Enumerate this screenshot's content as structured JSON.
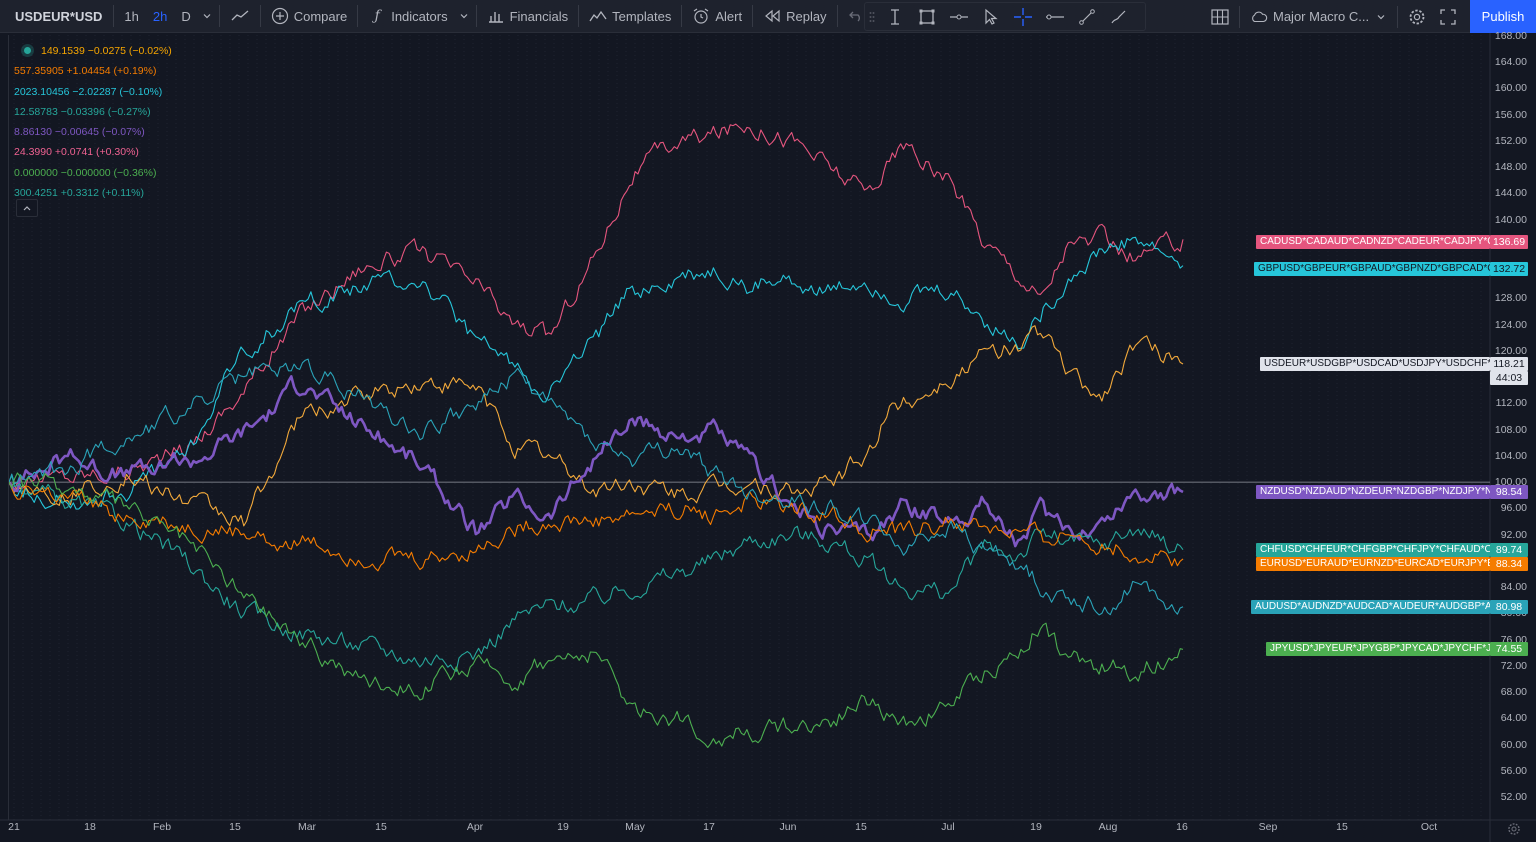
{
  "toolbar": {
    "symbol": "USDEUR*USD",
    "intervals": [
      "1h",
      "2h",
      "D"
    ],
    "active_interval": "2h",
    "compare_label": "Compare",
    "indicators_label": "Indicators",
    "financials_label": "Financials",
    "templates_label": "Templates",
    "alert_label": "Alert",
    "replay_label": "Replay",
    "layout_name": "Major Macro C...",
    "publish_label": "Publish"
  },
  "legend": [
    {
      "text": "149.1539  −0.0275 (−0.02%)",
      "color": "#f7a600"
    },
    {
      "text": "557.35905  +1.04454 (+0.19%)",
      "color": "#f57c00"
    },
    {
      "text": "2023.10456  −2.02287 (−0.10%)",
      "color": "#26c6da"
    },
    {
      "text": "12.58783  −0.03396 (−0.27%)",
      "color": "#26a69a"
    },
    {
      "text": "8.86130  −0.00645 (−0.07%)",
      "color": "#7e57c2"
    },
    {
      "text": "24.3990  +0.0741 (+0.30%)",
      "color": "#f06292"
    },
    {
      "text": "0.000000  −0.000000 (−0.36%)",
      "color": "#4caf50"
    },
    {
      "text": "300.4251  +0.3312 (+0.11%)",
      "color": "#26a69a"
    }
  ],
  "chart_data": {
    "type": "line",
    "title": "",
    "xlabel": "",
    "ylabel": "",
    "ylim": [
      48,
      169
    ],
    "grid": true,
    "y_ticks": [
      168,
      164,
      160,
      156,
      152,
      148,
      144,
      140,
      136,
      132,
      128,
      124,
      120,
      116,
      112,
      108,
      104,
      100,
      96,
      92,
      88,
      84,
      80,
      76,
      72,
      68,
      64,
      60,
      56,
      52
    ],
    "x_ticks": [
      "21",
      "18",
      "Feb",
      "15",
      "Mar",
      "15",
      "Apr",
      "19",
      "May",
      "17",
      "Jun",
      "15",
      "Jul",
      "19",
      "Aug",
      "16",
      "Sep",
      "15",
      "Oct"
    ],
    "baseline": 100,
    "series": [
      {
        "name": "CADUSD*CADAUD*CADNZD*CADEUR*CADJPY*CA...",
        "last": "136.69",
        "color": "#e5557e",
        "x": [
          0,
          0.05,
          0.1,
          0.15,
          0.2,
          0.25,
          0.3,
          0.35,
          0.4,
          0.43,
          0.46,
          0.5,
          0.53,
          0.57,
          0.6,
          0.63,
          0.67,
          0.7,
          0.73,
          0.76,
          0.8,
          0.83,
          0.86,
          0.88,
          0.9,
          0.93,
          0.96,
          1.0
        ],
        "values": [
          100,
          101,
          102,
          105,
          114,
          126,
          133,
          135,
          130,
          124,
          122,
          135,
          147,
          152,
          153,
          155,
          152,
          148,
          144,
          151,
          146,
          137,
          132,
          128,
          136,
          137,
          134,
          137
        ]
      },
      {
        "name": "GBPUSD*GBPEUR*GBPAUD*GBPNZD*GBPCAD*GB...",
        "last": "132.72",
        "color": "#26c6da",
        "x": [
          0,
          0.05,
          0.1,
          0.15,
          0.2,
          0.25,
          0.3,
          0.35,
          0.4,
          0.43,
          0.46,
          0.5,
          0.53,
          0.57,
          0.6,
          0.63,
          0.67,
          0.7,
          0.73,
          0.76,
          0.8,
          0.83,
          0.86,
          0.88,
          0.9,
          0.93,
          0.96,
          1.0
        ],
        "values": [
          100,
          97,
          99,
          104,
          120,
          127,
          130,
          131,
          121,
          118,
          114,
          122,
          129,
          131,
          132,
          130,
          131,
          129,
          131,
          128,
          129,
          125,
          121,
          126,
          131,
          135,
          137,
          133
        ]
      },
      {
        "name": "USDEUR*USDGBP*USDCAD*USDJPY*USDCHF*US...",
        "last": "118.21",
        "color": "#f2a93b",
        "x": [
          0,
          0.05,
          0.1,
          0.15,
          0.2,
          0.25,
          0.3,
          0.35,
          0.4,
          0.43,
          0.46,
          0.5,
          0.53,
          0.57,
          0.6,
          0.63,
          0.67,
          0.7,
          0.73,
          0.75,
          0.8,
          0.83,
          0.86,
          0.88,
          0.9,
          0.93,
          0.96,
          1.0
        ],
        "values": [
          100,
          98,
          101,
          97,
          94,
          110,
          113,
          115,
          114,
          106,
          104,
          99,
          100,
          98,
          99,
          100,
          98,
          100,
          104,
          111,
          116,
          119,
          121,
          123,
          117,
          113,
          121,
          118
        ]
      },
      {
        "name": "NZDUSD*NZDAUD*NZDEUR*NZDGBP*NZDJPY*NZ...",
        "last": "98.54",
        "color": "#7e57c2",
        "x": [
          0,
          0.05,
          0.1,
          0.15,
          0.2,
          0.25,
          0.3,
          0.35,
          0.4,
          0.43,
          0.46,
          0.5,
          0.53,
          0.57,
          0.6,
          0.63,
          0.67,
          0.7,
          0.73,
          0.76,
          0.8,
          0.83,
          0.86,
          0.88,
          0.9,
          0.93,
          0.96,
          1.0
        ],
        "values": [
          100,
          104,
          101,
          103,
          108,
          115,
          109,
          103,
          92,
          98,
          95,
          104,
          109,
          107,
          108,
          103,
          96,
          93,
          92,
          96,
          94,
          97,
          91,
          96,
          92,
          94,
          99,
          98.5
        ]
      },
      {
        "name": "CHFUSD*CHFEUR*CHFGBP*CHFJPY*CHFAUD*CH...",
        "last": "89.74",
        "color": "#26a69a",
        "x": [
          0,
          0.05,
          0.1,
          0.15,
          0.2,
          0.25,
          0.3,
          0.35,
          0.4,
          0.43,
          0.46,
          0.5,
          0.53,
          0.57,
          0.6,
          0.63,
          0.67,
          0.7,
          0.73,
          0.76,
          0.8,
          0.83,
          0.86,
          0.88,
          0.9,
          0.93,
          0.96,
          1.0
        ],
        "values": [
          100,
          97,
          94,
          88,
          80,
          77,
          75,
          73,
          74,
          79,
          81,
          82,
          84,
          86,
          88,
          91,
          92,
          91,
          88,
          84,
          83,
          90,
          89,
          92,
          91,
          90,
          93,
          89.7
        ]
      },
      {
        "name": "EURUSD*EURAUD*EURNZD*EURCAD*EURJPY*EU...",
        "last": "88.34",
        "color": "#f57c00",
        "x": [
          0,
          0.05,
          0.1,
          0.15,
          0.2,
          0.25,
          0.3,
          0.35,
          0.4,
          0.43,
          0.46,
          0.5,
          0.53,
          0.57,
          0.6,
          0.63,
          0.67,
          0.7,
          0.73,
          0.76,
          0.8,
          0.83,
          0.86,
          0.88,
          0.9,
          0.93,
          0.96,
          1.0
        ],
        "values": [
          100,
          97,
          95,
          93,
          92,
          91,
          89,
          88,
          90,
          93,
          94,
          94,
          95,
          96,
          95,
          97,
          96,
          95,
          93,
          92,
          94,
          93,
          92,
          91,
          92,
          91,
          89,
          88.3
        ]
      },
      {
        "name": "AUDUSD*AUDNZD*AUDCAD*AUDEUR*AUDGBP*AU...",
        "last": "80.98",
        "color": "#2aa3b8",
        "x": [
          0,
          0.05,
          0.1,
          0.15,
          0.2,
          0.25,
          0.3,
          0.35,
          0.4,
          0.43,
          0.46,
          0.5,
          0.53,
          0.57,
          0.6,
          0.63,
          0.67,
          0.7,
          0.73,
          0.76,
          0.8,
          0.83,
          0.86,
          0.88,
          0.9,
          0.93,
          0.96,
          1.0
        ],
        "values": [
          100,
          102,
          107,
          111,
          116,
          118,
          113,
          108,
          112,
          116,
          112,
          106,
          103,
          105,
          101,
          98,
          97,
          96,
          94,
          90,
          93,
          90,
          88,
          84,
          83,
          81,
          84,
          81
        ]
      },
      {
        "name": "JPYUSD*JPYEUR*JPYGBP*JPYCAD*JPYCHF*JP...",
        "last": "74.55",
        "color": "#4caf50",
        "x": [
          0,
          0.05,
          0.1,
          0.15,
          0.2,
          0.25,
          0.3,
          0.35,
          0.4,
          0.43,
          0.46,
          0.5,
          0.53,
          0.57,
          0.6,
          0.63,
          0.67,
          0.7,
          0.73,
          0.76,
          0.8,
          0.83,
          0.86,
          0.88,
          0.9,
          0.93,
          0.96,
          1.0
        ],
        "values": [
          100,
          99,
          96,
          91,
          83,
          76,
          70,
          69,
          72,
          70,
          73,
          74,
          66,
          64,
          61,
          62,
          63,
          64,
          67,
          63,
          66,
          71,
          74,
          79,
          73,
          72,
          71,
          74.5
        ]
      }
    ]
  },
  "price_axis_extra": {
    "countdown": "44:03"
  }
}
